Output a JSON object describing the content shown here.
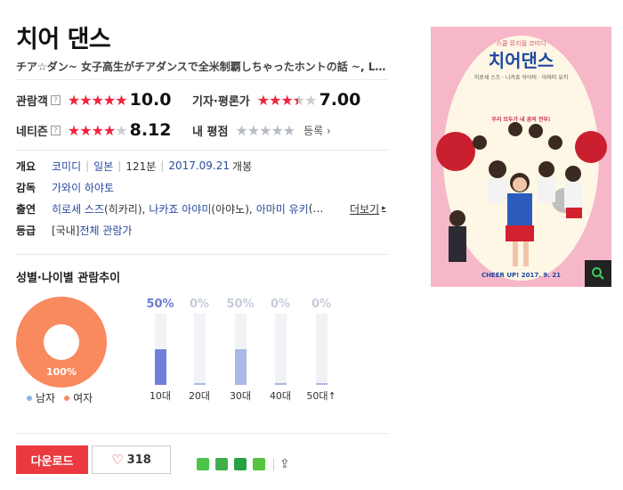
{
  "movie": {
    "title": "치어 댄스",
    "subtitle": "チア☆ダン~ 女子高生がチアダンスで全米制覇しちゃったホントの話 ~, Let's..."
  },
  "ratings": {
    "audience": {
      "label": "관람객",
      "score": "10.0",
      "stars_filled": 5
    },
    "critic": {
      "label": "기자·평론가",
      "score": "7.00",
      "stars_filled": 3.5
    },
    "netizen": {
      "label": "네티즌",
      "score": "8.12",
      "stars_filled": 4
    },
    "mine": {
      "label": "내 평점",
      "register": "등록"
    }
  },
  "info": {
    "overview_label": "개요",
    "genre": "코미디",
    "country": "일본",
    "runtime": "121분",
    "release_date": "2017.09.21",
    "release_suffix": "개봉",
    "director_label": "감독",
    "director": "가와이 하야토",
    "cast_label": "출연",
    "cast_1": "히로세 스즈",
    "cast_1_role": "(히카리),",
    "cast_2": "나카죠 아야미",
    "cast_2_role": "(아야노),",
    "cast_3": "아마미 유키",
    "cast_3_role": "(…",
    "more": "더보기",
    "grade_label": "등급",
    "grade_prefix": "[국내]",
    "grade": "전체 관람가"
  },
  "demographics": {
    "title": "성별·나이별 관람추이",
    "gender": {
      "female_pct_label": "100%",
      "male_legend": "남자",
      "female_legend": "여자"
    },
    "ages": [
      {
        "label": "10대",
        "pct_label": "50%",
        "value": 0.5,
        "highlight": true
      },
      {
        "label": "20대",
        "pct_label": "0%",
        "value": 0.0,
        "highlight": false
      },
      {
        "label": "30대",
        "pct_label": "50%",
        "value": 0.5,
        "highlight": false
      },
      {
        "label": "40대",
        "pct_label": "0%",
        "value": 0.0,
        "highlight": false
      },
      {
        "label": "50대↑",
        "pct_label": "0%",
        "value": 0.0,
        "highlight": false
      }
    ]
  },
  "actions": {
    "download": "다운로드",
    "likes": "318"
  },
  "poster": {
    "small_text": "스쿨 뮤지컬 코미디",
    "title": "치어댄스",
    "cast_text": "히로세 스즈 · 나카죠 아야미 · 아마미 유키",
    "tagline": "우리 모두가 내 꿈의 전부!",
    "bottom_text": "CHEER UP! 2017. 9. 21"
  },
  "colors": {
    "accent_red": "#ea3a3f",
    "link_blue": "#2a4ba0",
    "female": "#f98a5e",
    "male": "#8ab8e6",
    "bar_highlight": "#6f80db"
  }
}
